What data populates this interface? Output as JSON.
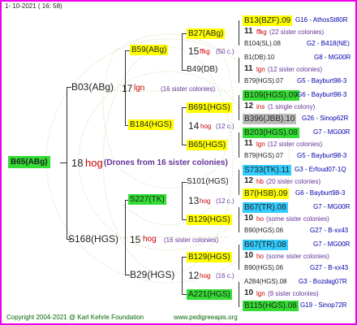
{
  "header": {
    "date": "1- 10-2021 ( 16: 58)"
  },
  "footer": {
    "copyright": "Copyright 2004-2021 @ Karl Kehrle Foundation",
    "website": "www.pedigreeapis.org"
  },
  "colors": {
    "frame": "#ee00ee",
    "yellow_box": "#ffff00",
    "green_box": "#33dd33",
    "cyan_box": "#33ccff",
    "gray_box": "#bbbbbb",
    "highlight_text": "#cc0000",
    "note_text": "#663399"
  },
  "root": {
    "id": "B65(ABg)",
    "gen": "18",
    "race": "hog",
    "note": "(Drones from 16 sister colonies)"
  },
  "gen1": [
    {
      "id": "B03(ABg)",
      "gen": "17",
      "race": "lgn",
      "note": "(16 sister colonies)"
    },
    {
      "id": "S168(HGS)",
      "gen": "15",
      "race": "hog",
      "note": "(16 sister colonies)"
    }
  ],
  "gen2": [
    {
      "id": "B59(ABg)",
      "gen": "15",
      "race": "ffkg",
      "note": "(50 c.)"
    },
    {
      "id": "B184(HGS)",
      "gen": "14",
      "race": "hog",
      "note": "(12 c.)"
    },
    {
      "id": "S227(TK)",
      "gen": "13",
      "race": "hog",
      "note": "(12 c.)"
    },
    {
      "id": "B29(HGS)",
      "gen": "12",
      "race": "hog",
      "note": "(16 c.)"
    }
  ],
  "gen3": [
    {
      "id": "B27(ABg)"
    },
    {
      "id": "B49(DB)"
    },
    {
      "id": "B691(HGS)"
    },
    {
      "id": "B65(HGS)"
    },
    {
      "id": "S101(HGS)"
    },
    {
      "id": "B129(HGS)"
    },
    {
      "id": "B129(HGS)"
    },
    {
      "id": "A221(HGS)"
    }
  ],
  "gen4": [
    {
      "id": "B13(BZF).09",
      "ref": "G16 - AthosSt80R"
    },
    {
      "count": "11",
      "race": "ffkg",
      "note": "(22 sister colonies)"
    },
    {
      "id": "B104(SL).08",
      "ref": "G2 - B418(NE)"
    },
    {
      "id": "B1(DB).10",
      "ref": "G8 - MG00R"
    },
    {
      "count": "11",
      "race": "lgn",
      "note": "(12 sister colonies)"
    },
    {
      "id": "B79(HGS).07",
      "ref": "G5 - Bayburt98-3"
    },
    {
      "id": "B109(HGS).09",
      "ref": "G6 - Bayburt98-3"
    },
    {
      "count": "12",
      "race": "ins",
      "note": "(1 single colony)"
    },
    {
      "id": "B396(JBB).10",
      "ref": "G26 - Sinop62R"
    },
    {
      "id": "B203(HGS).08",
      "ref": "G7 - MG00R"
    },
    {
      "count": "11",
      "race": "lgn",
      "note": "(12 sister colonies)"
    },
    {
      "id": "B79(HGS).07",
      "ref": "G5 - Bayburt98-3"
    },
    {
      "id": "S733(TK).11",
      "ref": "G3 - Erfoud07-1Q"
    },
    {
      "count": "12",
      "race": "hb",
      "note": "(20 sister colonies)"
    },
    {
      "id": "B7(HSB).09",
      "ref": "G6 - Bayburt98-3"
    },
    {
      "id": "B67(TR).08",
      "ref": "G7 - MG00R"
    },
    {
      "count": "10",
      "race": "ho",
      "note": "(some sister colonies)"
    },
    {
      "id": "B90(HGS).06",
      "ref": "G27 - B-xx43"
    },
    {
      "id": "B67(TR).08",
      "ref": "G7 - MG00R"
    },
    {
      "count": "10",
      "race": "ho",
      "note": "(some sister colonies)"
    },
    {
      "id": "B90(HGS).06",
      "ref": "G27 - B-xx43"
    },
    {
      "id": "A284(HGS).08",
      "ref": "G3 - Bozdag07R"
    },
    {
      "count": "10",
      "race": "lgn",
      "note": "(9 sister colonies)"
    },
    {
      "id": "B115(HGS).08",
      "ref": "G19 - Sinop72R"
    }
  ]
}
